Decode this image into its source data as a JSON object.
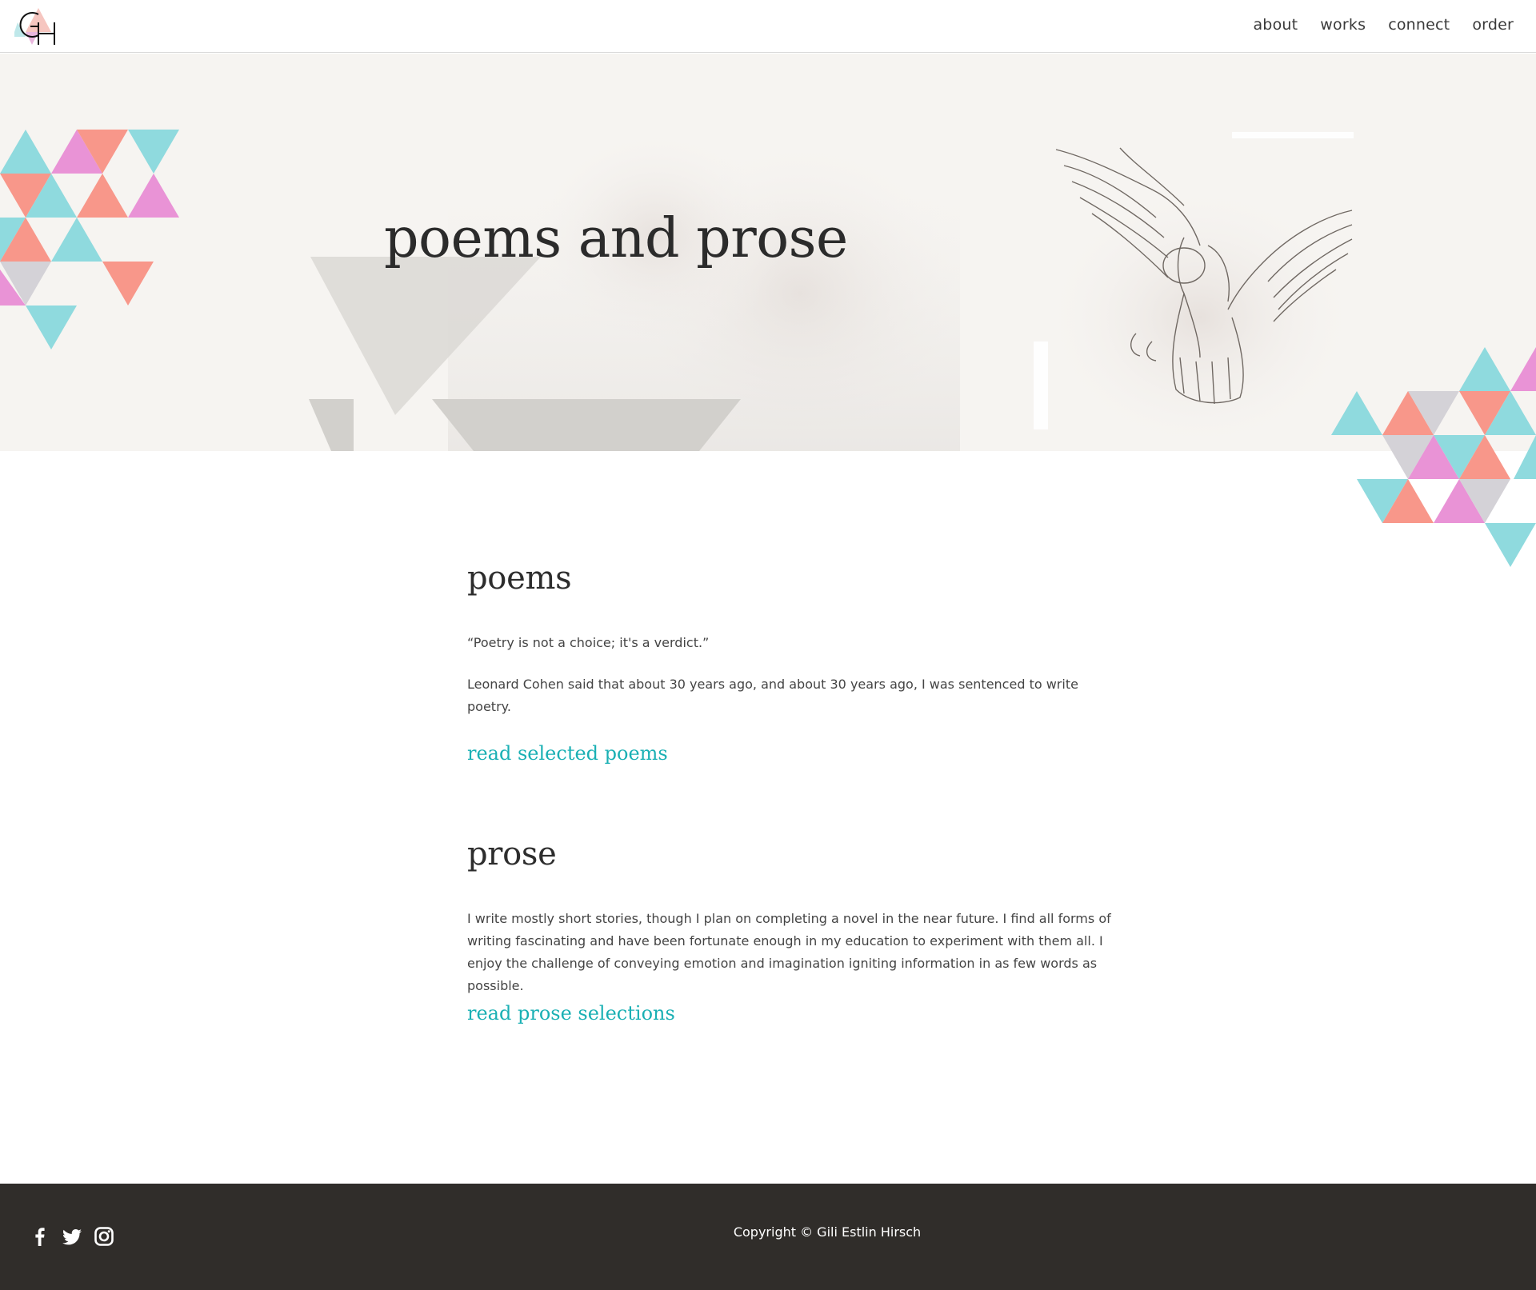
{
  "header": {
    "logo_text": "GH",
    "nav": [
      {
        "label": "about"
      },
      {
        "label": "works"
      },
      {
        "label": "connect"
      },
      {
        "label": "order"
      }
    ]
  },
  "hero": {
    "title": "poems and prose"
  },
  "sections": {
    "poems": {
      "title": "poems",
      "quote": "“Poetry is not a choice; it's a verdict.”",
      "body": "Leonard Cohen said that about 30 years ago, and about 30 years ago, I was sentenced to write poetry.",
      "link": "read selected poems"
    },
    "prose": {
      "title": "prose",
      "body": "I write mostly short stories, though I plan on completing a novel in the near future. I find all forms of writing fascinating and have been fortunate enough in my education to experiment with them all. I enjoy the challenge of conveying emotion and imagination igniting information in as few words as possible.",
      "link": "read prose selections"
    }
  },
  "footer": {
    "social": [
      {
        "icon": "facebook-icon"
      },
      {
        "icon": "twitter-icon"
      },
      {
        "icon": "instagram-icon"
      }
    ],
    "copyright": "Copyright © Gili Estlin Hirsch"
  },
  "colors": {
    "accent_link": "#1ab0b4",
    "footer_bg": "#302d2a",
    "tri_cyan": "#8fdade",
    "tri_coral": "#f8978a",
    "tri_pink": "#e993d6",
    "tri_gray": "#d4d2d7"
  }
}
